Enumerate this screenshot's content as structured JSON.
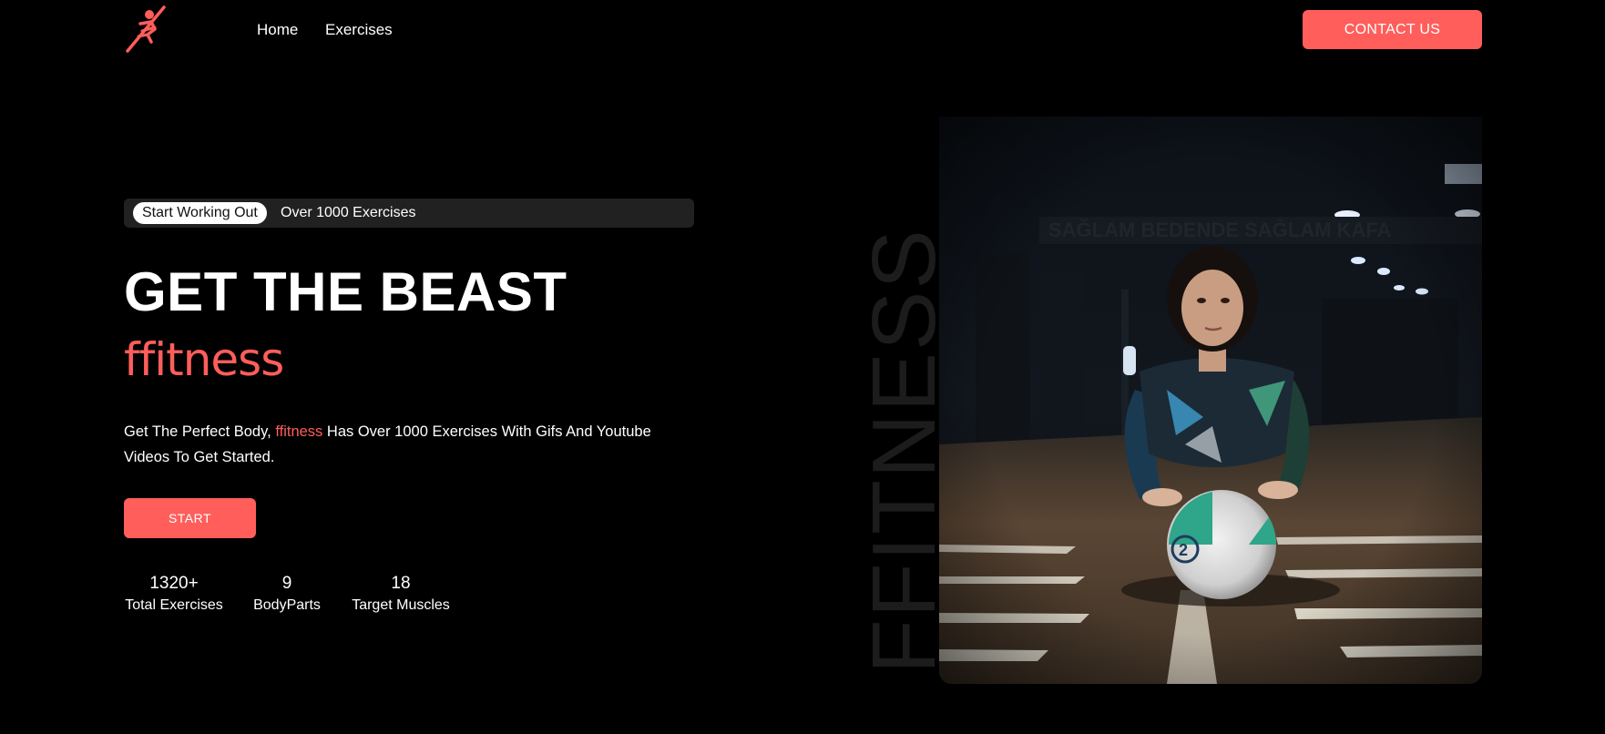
{
  "nav": {
    "logo_icon": "runner-logo-icon",
    "links": [
      {
        "label": "Home"
      },
      {
        "label": "Exercises"
      }
    ],
    "contact_label": "CONTACT US"
  },
  "hero": {
    "pill_label": "Start Working Out",
    "tagline": "Over 1000 Exercises",
    "title": "GET THE BEAST",
    "brand": "ffitness",
    "description": {
      "before": "Get The Perfect Body,",
      "brand": "ffitness",
      "after": "Has Over 1000 Exercises With Gifs And Youtube Videos To Get Started."
    },
    "start_label": "START",
    "stats": [
      {
        "value": "1320+",
        "label": "Total Exercises"
      },
      {
        "value": "9",
        "label": "BodyParts"
      },
      {
        "value": "18",
        "label": "Target Muscles"
      }
    ],
    "vertical_word": "FFITNESS",
    "image_alt": "woman-with-medicine-ball-photo"
  },
  "colors": {
    "background": "#000000",
    "accent": "#ff5e5b",
    "tagline_bar": "#212121",
    "vertical_word": "#1c1c1c"
  }
}
